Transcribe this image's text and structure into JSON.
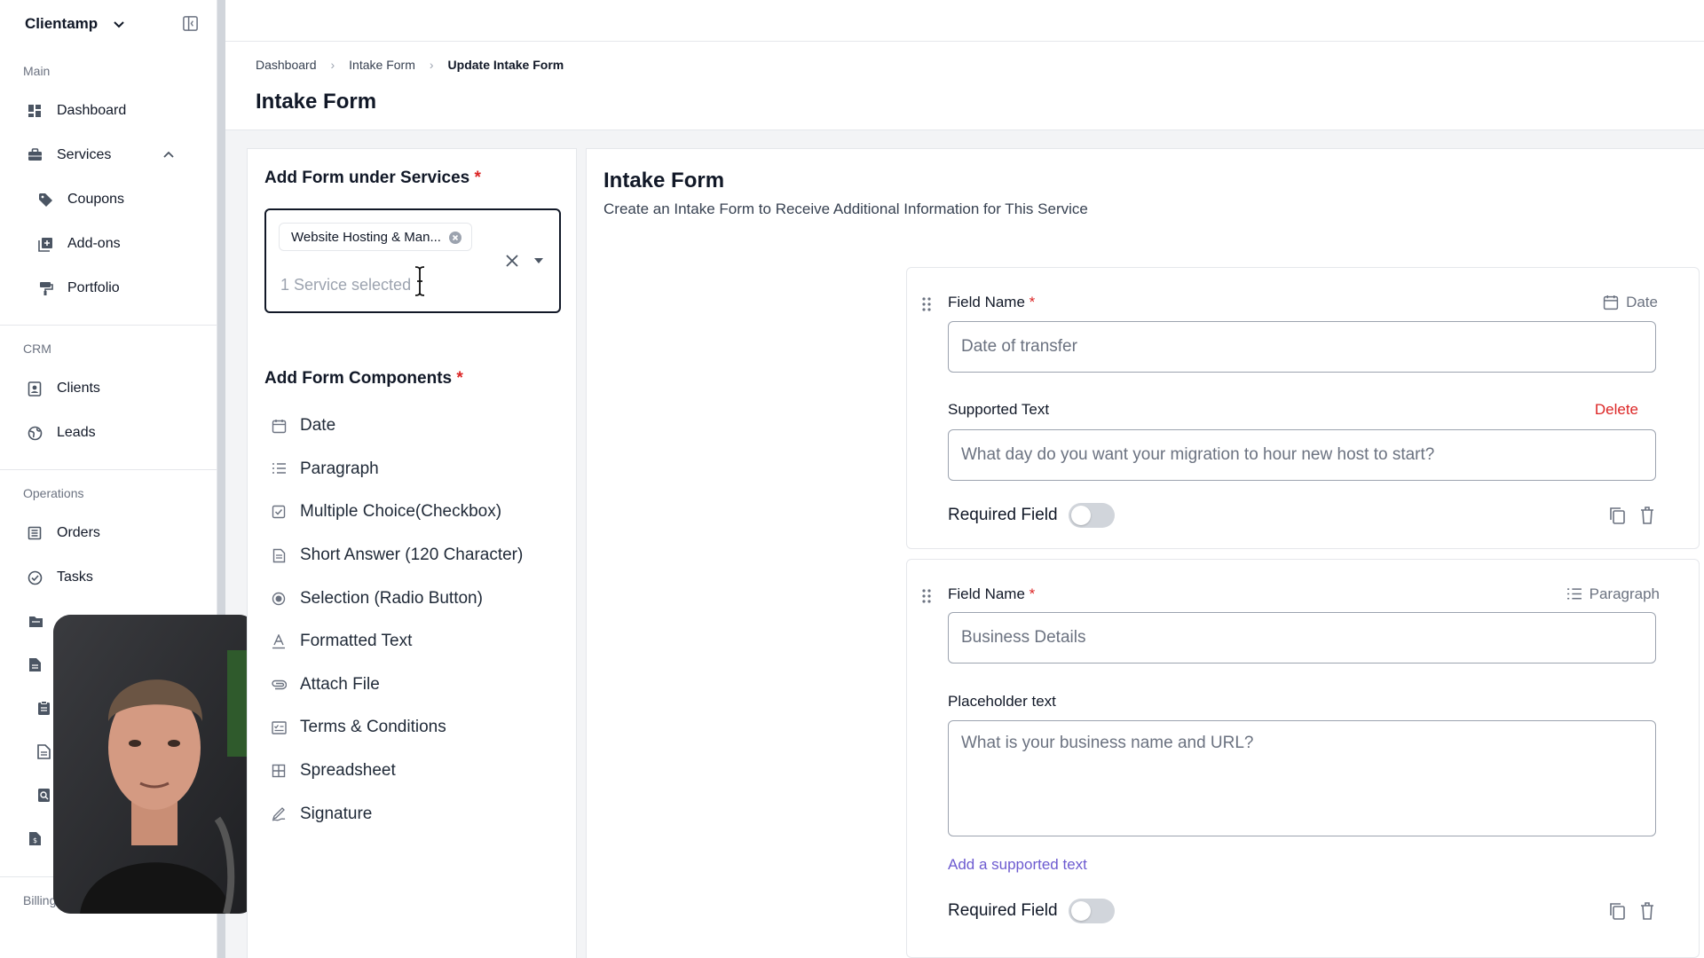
{
  "sidebar": {
    "app_name": "Clientamp",
    "sections": [
      {
        "label": "Main"
      },
      {
        "label": "CRM"
      },
      {
        "label": "Operations"
      },
      {
        "label": "Billing"
      }
    ],
    "main_items": [
      {
        "label": "Dashboard",
        "icon": "grid-icon"
      },
      {
        "label": "Services",
        "icon": "briefcase-icon"
      },
      {
        "label": "Coupons",
        "icon": "tag-icon"
      },
      {
        "label": "Add-ons",
        "icon": "add-box-icon"
      },
      {
        "label": "Portfolio",
        "icon": "paint-roller-icon"
      }
    ],
    "crm_items": [
      {
        "label": "Clients",
        "icon": "contact-card-icon"
      },
      {
        "label": "Leads",
        "icon": "globe-icon"
      }
    ],
    "ops_items": [
      {
        "label": "Orders",
        "icon": "list-icon"
      },
      {
        "label": "Tasks",
        "icon": "check-circle-icon"
      }
    ]
  },
  "breadcrumb": {
    "items": [
      "Dashboard",
      "Intake Form"
    ],
    "current": "Update Intake Form"
  },
  "page_title": "Intake Form",
  "left_panel": {
    "services_title": "Add Form under Services",
    "required_mark": "*",
    "selected_chip": "Website Hosting & Man...",
    "selection_summary": "1 Service selected",
    "components_title": "Add Form Components",
    "components": [
      {
        "label": "Date",
        "icon": "calendar-icon"
      },
      {
        "label": "Paragraph",
        "icon": "paragraph-icon"
      },
      {
        "label": "Multiple Choice(Checkbox)",
        "icon": "checkbox-icon"
      },
      {
        "label": "Short Answer (120 Character)",
        "icon": "document-icon"
      },
      {
        "label": "Selection (Radio Button)",
        "icon": "radio-icon"
      },
      {
        "label": "Formatted Text",
        "icon": "text-format-icon"
      },
      {
        "label": "Attach File",
        "icon": "paperclip-icon"
      },
      {
        "label": "Terms & Conditions",
        "icon": "terms-icon"
      },
      {
        "label": "Spreadsheet",
        "icon": "table-icon"
      },
      {
        "label": "Signature",
        "icon": "signature-icon"
      }
    ]
  },
  "right_panel": {
    "title": "Intake Form",
    "subtitle": "Create an Intake Form to Receive Additional Information for This Service",
    "fields": [
      {
        "field_name_label": "Field Name",
        "type_label": "Date",
        "field_name_value": "Date of transfer",
        "secondary_label": "Supported Text",
        "delete_label": "Delete",
        "secondary_value": "What day do you want your migration to hour new host to start?",
        "required_label": "Required Field",
        "required_on": false
      },
      {
        "field_name_label": "Field Name",
        "type_label": "Paragraph",
        "field_name_value": "Business Details",
        "secondary_label": "Placeholder text",
        "secondary_value": "What is your business name and URL?",
        "add_link": "Add a supported text",
        "required_label": "Required Field",
        "required_on": false
      }
    ]
  },
  "colors": {
    "required": "#dc2626",
    "link": "#6d5bd0",
    "delete": "#dc2626"
  }
}
